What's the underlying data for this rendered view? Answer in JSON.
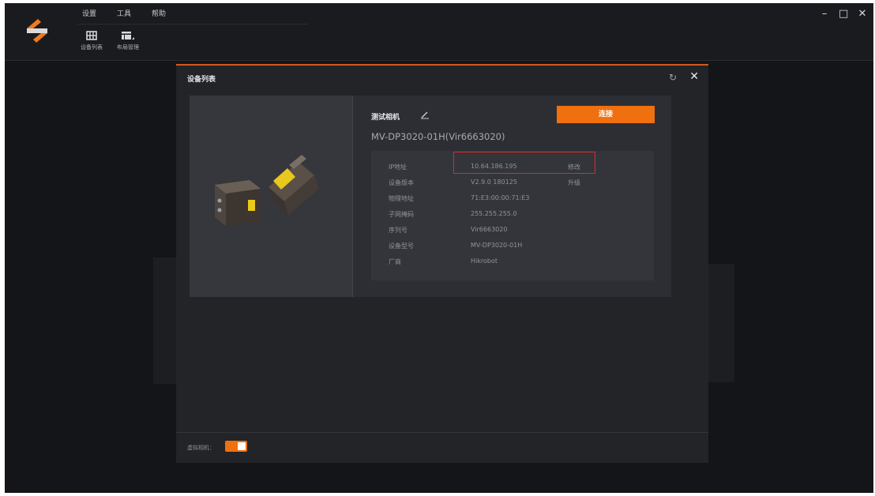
{
  "menu": {
    "settings": "设置",
    "tools": "工具",
    "help": "帮助"
  },
  "toolbar": {
    "device_list": "设备列表",
    "layout_manage": "布局管理"
  },
  "window_controls": {
    "minimize": "–",
    "maximize": "□",
    "close": "✕"
  },
  "dialog": {
    "title": "设备列表",
    "refresh_icon": "↻",
    "close_icon": "✕",
    "camera": {
      "name": "测试相机",
      "model_line": "MV-DP3020-01H(Vir6663020)",
      "connect_label": "连接"
    },
    "info_rows": [
      {
        "label": "IP地址",
        "value": "10.64.186.195",
        "action": "修改"
      },
      {
        "label": "设备版本",
        "value": "V2.9.0 180125",
        "action": "升级"
      },
      {
        "label": "物理地址",
        "value": "71:E3:00:00:71:E3",
        "action": ""
      },
      {
        "label": "子网掩码",
        "value": "255.255.255.0",
        "action": ""
      },
      {
        "label": "序列号",
        "value": "Vir6663020",
        "action": ""
      },
      {
        "label": "设备型号",
        "value": "MV-DP3020-01H",
        "action": ""
      },
      {
        "label": "厂商",
        "value": "Hikrobot",
        "action": ""
      }
    ],
    "virtual_camera_label": "虚拟相机：",
    "virtual_camera_enabled": true
  },
  "colors": {
    "accent": "#f0700f",
    "highlight": "#e02828"
  }
}
